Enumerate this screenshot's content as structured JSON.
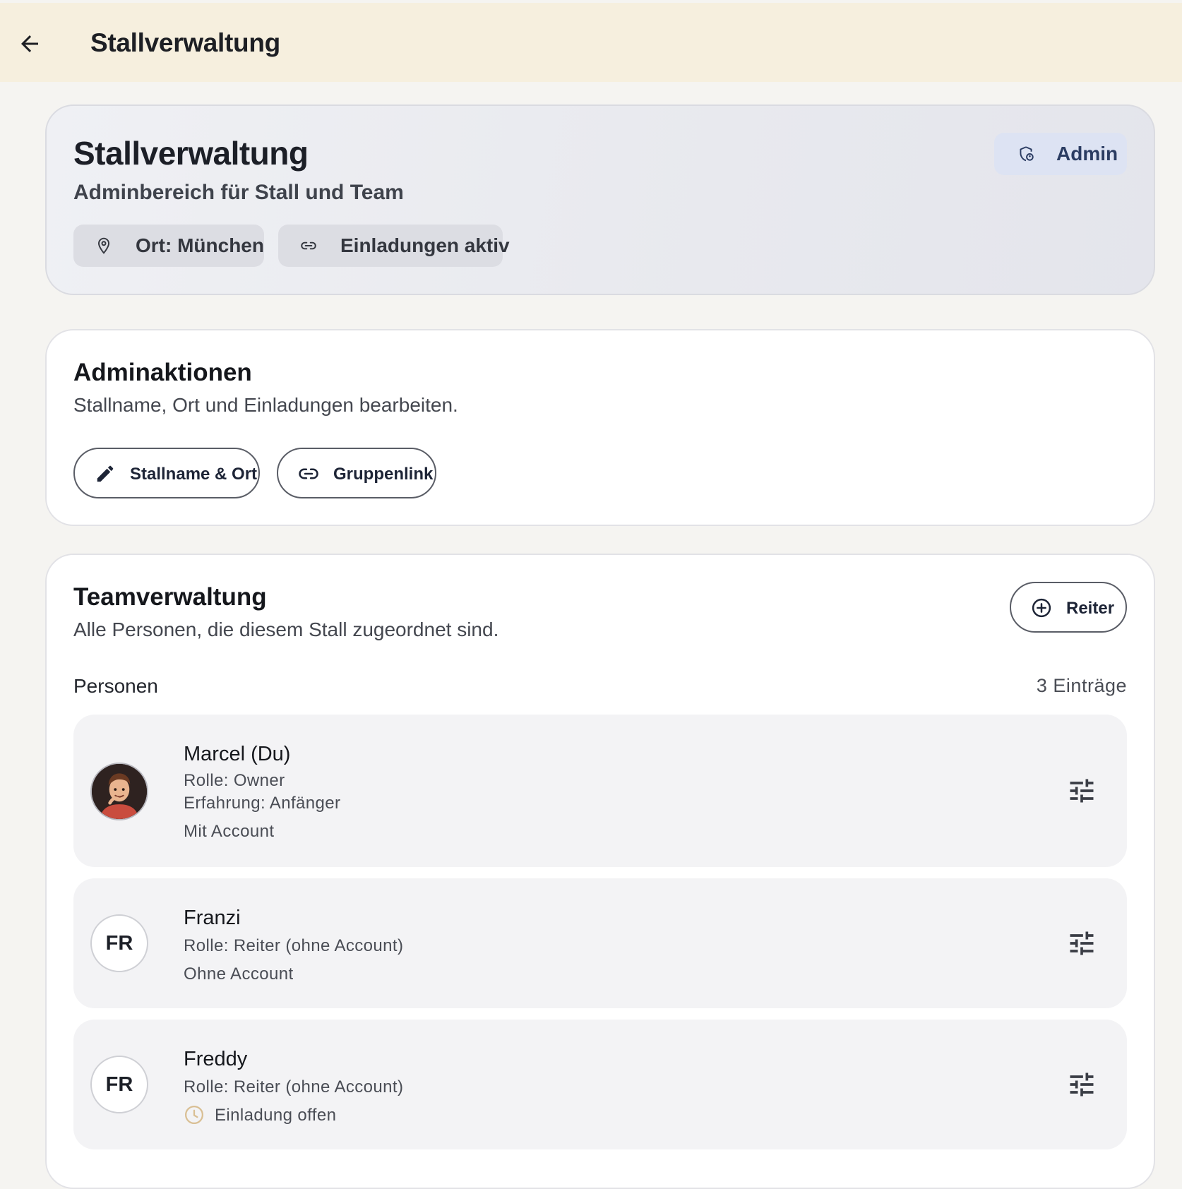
{
  "appbar": {
    "title": "Stallverwaltung",
    "back_icon": "arrow-left-icon"
  },
  "hero": {
    "title": "Stallverwaltung",
    "subtitle": "Adminbereich für Stall und Team",
    "badge": {
      "label": "Admin",
      "icon": "shield-person-icon"
    },
    "chips": [
      {
        "label": "Ort: München",
        "icon": "location-pin-icon"
      },
      {
        "label": "Einladungen aktiv",
        "icon": "link-icon"
      }
    ]
  },
  "actions": {
    "title": "Adminaktionen",
    "subtitle": "Stallname, Ort und Einladungen bearbeiten.",
    "buttons": [
      {
        "label": "Stallname & Ort",
        "icon": "pencil-icon"
      },
      {
        "label": "Gruppenlink",
        "icon": "link-icon"
      }
    ]
  },
  "team": {
    "title": "Teamverwaltung",
    "subtitle": "Alle Personen, die diesem Stall zugeordnet sind.",
    "add_button": {
      "label": "Reiter",
      "icon": "add-circle-icon"
    },
    "list_label": "Personen",
    "count_label": "3 Einträge",
    "people": [
      {
        "name": "Marcel (Du)",
        "role": "Rolle: Owner",
        "experience": "Erfahrung: Anfänger",
        "status": "Mit Account",
        "avatar": "photo"
      },
      {
        "name": "Franzi",
        "role": "Rolle: Reiter (ohne Account)",
        "status": "Ohne Account",
        "initials": "FR"
      },
      {
        "name": "Freddy",
        "role": "Rolle: Reiter (ohne Account)",
        "status": "Einladung offen",
        "status_icon": "clock-icon",
        "initials": "FR"
      }
    ]
  },
  "colors": {
    "appbar_bg": "#f6efde",
    "page_bg": "#f5f4f1",
    "badge_bg": "#dde3f3",
    "pending_accent": "#d9bf94"
  }
}
